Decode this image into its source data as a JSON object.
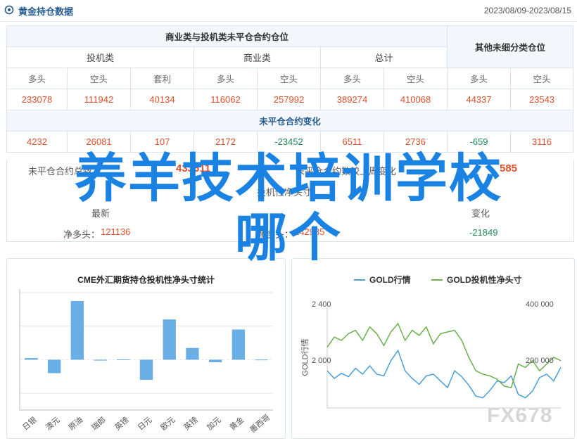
{
  "header": {
    "title": "黄金持仓数据",
    "date_range": "2023/08/09-2023/08/15"
  },
  "table": {
    "group_title": "商业类与投机类未平仓合约仓位",
    "other_title": "其他未细分类仓位",
    "groups": [
      "投机类",
      "商业类",
      "总计"
    ],
    "col_labels": [
      "多头",
      "空头",
      "套利",
      "多头",
      "空头",
      "多头",
      "空头",
      "多头",
      "空头"
    ],
    "open_interest": [
      "233078",
      "111942",
      "40134",
      "116062",
      "257992",
      "389274",
      "410068",
      "44337",
      "23543"
    ],
    "change_title": "未平仓合约变化",
    "changes": [
      "4232",
      "26081",
      "107",
      "2172",
      "-23452",
      "6511",
      "2736",
      "-659",
      "3116"
    ]
  },
  "net": {
    "total_label": "未平仓合约总数",
    "total_value": "433611",
    "change_label": "未平仓合约数较上周变化",
    "change_value": "585",
    "pos_label": "投机性净头寸",
    "latest_label": "最新",
    "pos_change_label": "变化",
    "net_long_label": "净多头：",
    "net_long_value": "121136",
    "net_long2_label": "净多头：",
    "net_long2_value": "142985",
    "net_change_value": "-21849"
  },
  "chart_left": {
    "chart_data": {
      "type": "bar",
      "title": "CME外汇期货持仓投机性净头寸统计",
      "categories": [
        "日银",
        "澳元",
        "原油",
        "瑞郎",
        "英镑",
        "日元",
        "欧元",
        "英镑",
        "加元",
        "黄金",
        "墨西哥"
      ],
      "values": [
        0.1,
        -0.8,
        3.5,
        -0.05,
        0.02,
        -1.2,
        2.4,
        0.7,
        -0.15,
        1.8,
        0.01
      ],
      "ylim": [
        -3,
        4
      ],
      "grid": true
    }
  },
  "chart_right": {
    "chart_data": {
      "type": "line",
      "series": [
        {
          "name": "GOLD行情",
          "color": "#4a9fd8",
          "values": [
            2020,
            1975,
            2005,
            1985,
            2035,
            2000,
            2050,
            2000,
            1990,
            2080,
            2140,
            2020,
            1975,
            1940,
            1990,
            2000,
            1960,
            1920,
            2020,
            1985,
            1935,
            1870,
            1860,
            1905,
            1960,
            1950,
            1990,
            1880,
            1860,
            1900,
            1980,
            2000,
            1960,
            2040
          ]
        },
        {
          "name": "GOLD投机性净头寸",
          "color": "#6ab04c",
          "values": [
            2160,
            2220,
            2200,
            2240,
            2260,
            2200,
            2280,
            2240,
            2170,
            2250,
            2300,
            2200,
            2260,
            2230,
            2280,
            2180,
            2240,
            2250,
            2260,
            2200,
            2100,
            2020,
            2000,
            1990,
            1970,
            1930,
            1920,
            2060,
            2040,
            2080,
            2020,
            2060,
            2100,
            2080
          ]
        }
      ],
      "y_left_label": "GOLD行情",
      "y_left_ticks": [
        "2 400",
        "2 000"
      ],
      "y_right_ticks": [
        "400 000",
        "200 000"
      ],
      "ylim": [
        1800,
        2400
      ]
    }
  },
  "overlay": {
    "line1": "养羊技术培训学校",
    "line2": "哪个"
  },
  "watermark": "FX678"
}
